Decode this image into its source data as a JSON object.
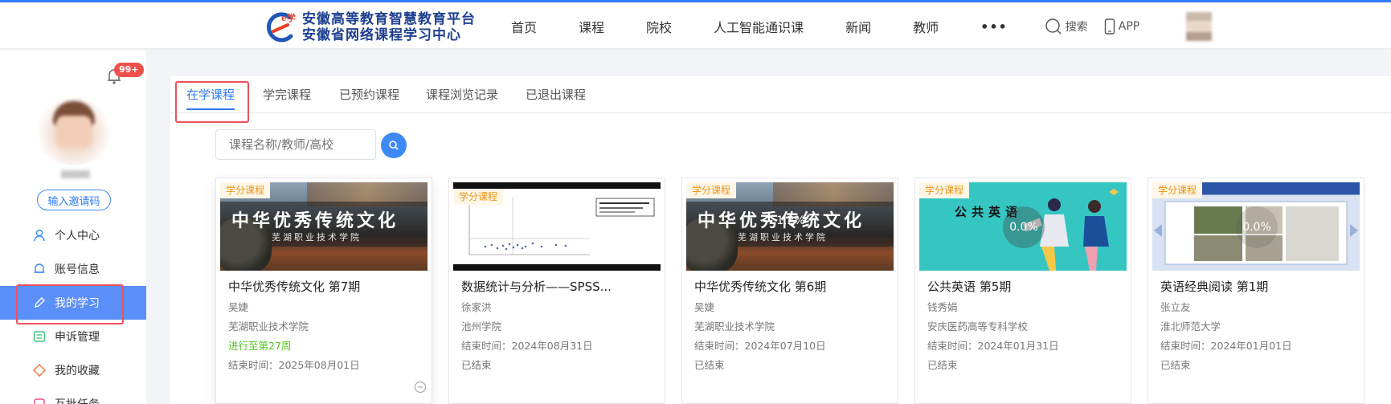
{
  "header": {
    "logo_line1": "安徽高等教育智慧教育平台",
    "logo_line2": "安徽省网络课程学习中心",
    "nav": [
      "首页",
      "课程",
      "院校",
      "人工智能通识课",
      "新闻",
      "教师"
    ],
    "more": "•••",
    "search_label": "搜索",
    "app_label": "APP"
  },
  "sidebar": {
    "badge": "99+",
    "invite_label": "输入邀请码",
    "menu": [
      {
        "label": "个人中心",
        "icon": "user-icon"
      },
      {
        "label": "账号信息",
        "icon": "bell-icon"
      },
      {
        "label": "我的学习",
        "icon": "pencil-icon",
        "active": true
      },
      {
        "label": "申诉管理",
        "icon": "list-icon"
      },
      {
        "label": "我的收藏",
        "icon": "tag-icon"
      },
      {
        "label": "互批任务",
        "icon": "task-icon"
      }
    ]
  },
  "tabs": [
    "在学课程",
    "学完课程",
    "已预约课程",
    "课程浏览记录",
    "已退出课程"
  ],
  "search": {
    "placeholder": "课程名称/教师/高校"
  },
  "courses": [
    {
      "tag": "学分课程",
      "title": "中华优秀传统文化 第7期",
      "teacher": "吴婕",
      "school": "芜湖职业技术学院",
      "progress": "进行至第27周",
      "end": "结束时间：2025年08月01日",
      "thumb_big": "中华优秀传统文化",
      "thumb_small": "芜湖职业技术学院"
    },
    {
      "tag": "学分课程",
      "title": "数据统计与分析——SPSS...",
      "teacher": "徐家洪",
      "school": "池州学院",
      "end": "结束时间：2024年08月31日",
      "status": "已结束"
    },
    {
      "tag": "学分课程",
      "title": "中华优秀传统文化 第6期",
      "teacher": "吴婕",
      "school": "芜湖职业技术学院",
      "end": "结束时间：2024年07月10日",
      "status": "已结束",
      "percent": "1.2%",
      "thumb_big": "中华优秀传统文化",
      "thumb_small": "芜湖职业技术学院"
    },
    {
      "tag": "学分课程",
      "title": "公共英语 第5期",
      "teacher": "钱秀娟",
      "school": "安庆医药高等专科学校",
      "end": "结束时间：2024年01月31日",
      "status": "已结束",
      "percent": "0.0%",
      "thumb_text": "公共英语"
    },
    {
      "tag": "学分课程",
      "title": "英语经典阅读 第1期",
      "teacher": "张立友",
      "school": "淮北师范大学",
      "end": "结束时间：2024年01月01日",
      "status": "已结束",
      "percent": "0.0%"
    }
  ]
}
